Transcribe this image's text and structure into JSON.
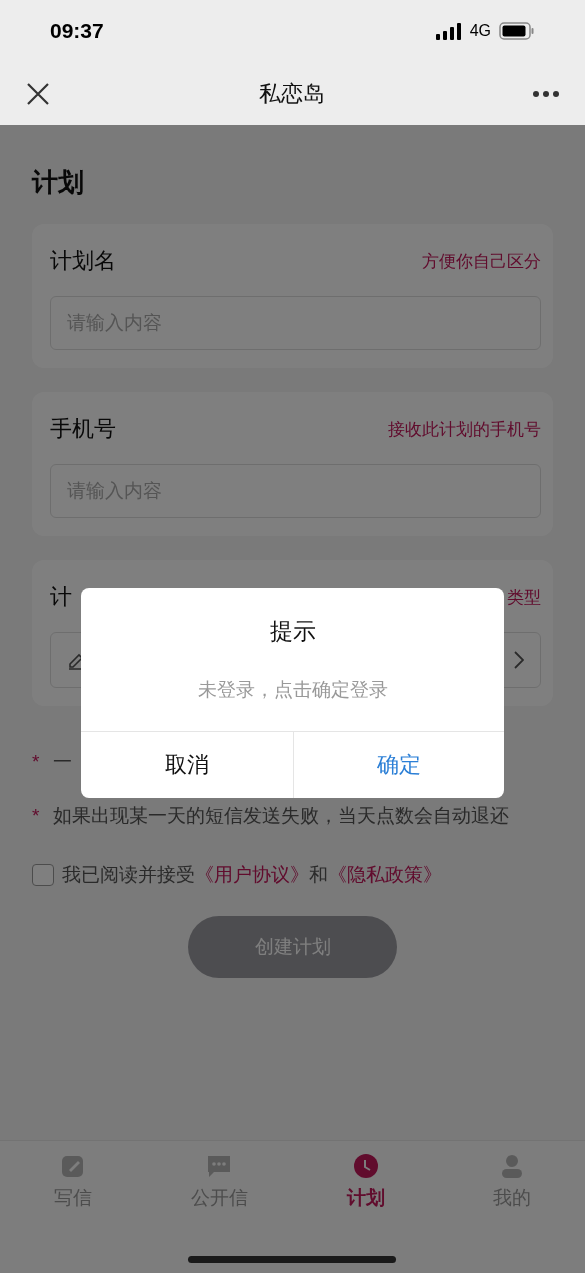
{
  "status_bar": {
    "time": "09:37",
    "network": "4G"
  },
  "nav": {
    "title": "私恋岛"
  },
  "page": {
    "title": "计划",
    "cards": [
      {
        "label": "计划名",
        "hint": "方便你自己区分",
        "kind": "text",
        "placeholder": "请输入内容"
      },
      {
        "label": "手机号",
        "hint": "接收此计划的手机号",
        "kind": "text",
        "placeholder": "请输入内容"
      },
      {
        "label": "计",
        "hint": "类型",
        "kind": "picker"
      }
    ],
    "notes": [
      {
        "mark": "*",
        "text": "一"
      },
      {
        "mark": "*",
        "text": "如果出现某一天的短信发送失败，当天点数会自动退还"
      }
    ],
    "agreement": {
      "checked": false,
      "text": "我已阅读并接受",
      "link_1": "《用户协议》",
      "joiner": "和",
      "link_2": "《隐私政策》"
    },
    "button": "创建计划"
  },
  "tab_bar": [
    {
      "label": "写信",
      "selected": false
    },
    {
      "label": "公开信",
      "selected": false
    },
    {
      "label": "计划",
      "selected": true
    },
    {
      "label": "我的",
      "selected": false
    }
  ],
  "dialog": {
    "title": "提示",
    "message": "未登录，点击确定登录",
    "cancel": "取消",
    "confirm": "确定"
  }
}
